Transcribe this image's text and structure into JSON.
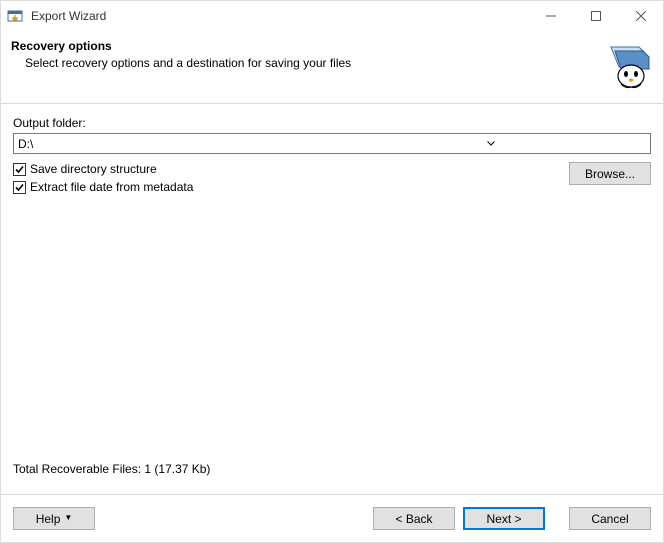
{
  "window": {
    "title": "Export Wizard"
  },
  "header": {
    "title": "Recovery options",
    "subtitle": "Select recovery options and a destination for saving your files"
  },
  "output_folder": {
    "label": "Output folder:",
    "value": "D:\\"
  },
  "options": {
    "save_dir_structure": "Save directory structure",
    "extract_date_metadata": "Extract file date from metadata",
    "browse": "Browse..."
  },
  "status": {
    "text": "Total Recoverable Files: 1 (17.37 Kb)"
  },
  "footer": {
    "help": "Help",
    "back": "< Back",
    "next": "Next >",
    "cancel": "Cancel"
  }
}
